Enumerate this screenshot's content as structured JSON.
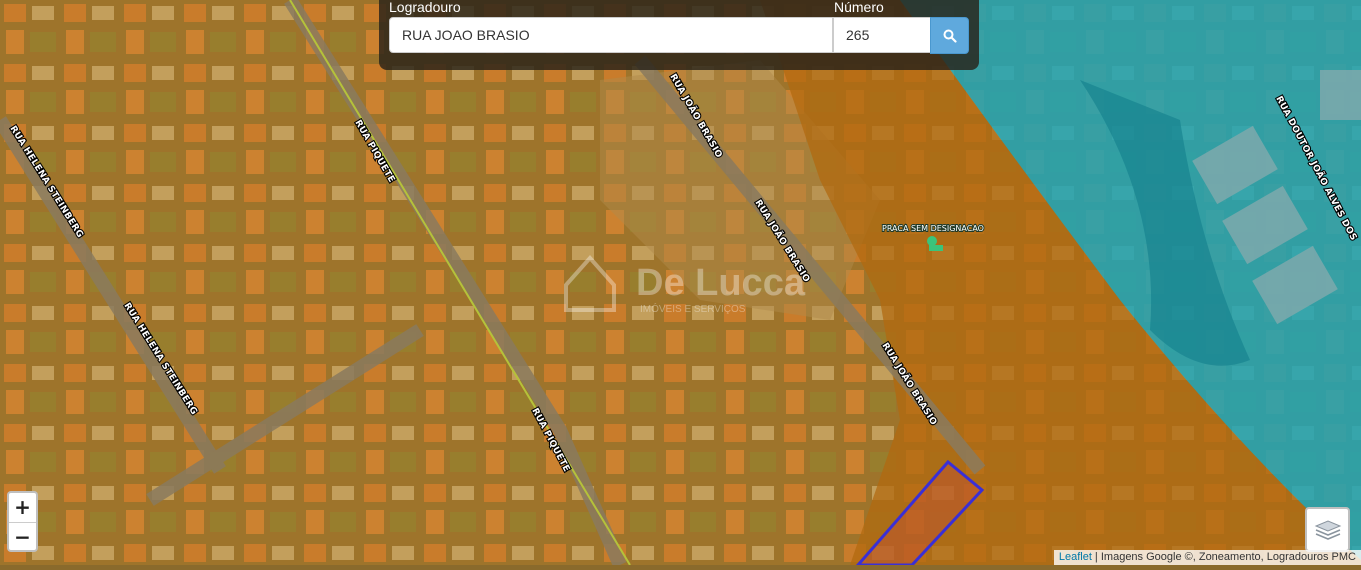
{
  "search": {
    "street_label": "Logradouro",
    "street_value": "RUA JOAO BRASIO",
    "number_label": "Número",
    "number_value": "265",
    "button_icon": "search-icon"
  },
  "map": {
    "street_labels": {
      "helena_1": "RUA HELENA STEINBERG",
      "helena_2": "RUA HELENA STEINBERG",
      "piquete_1": "RUA PIQUETE",
      "piquete_2": "RUA PIQUETE",
      "joao_brasio_1": "RUA JOÃO BRASIO",
      "joao_brasio_2": "RUA JOÃO BRASIO",
      "joao_brasio_3": "RUA JOÃO BRASIO",
      "doutor": "RUA DOUTOR JOÃO ALVES DOS"
    },
    "poi_label": "PRACA SEM DESIGNACAO",
    "watermark": "De Lucca",
    "watermark_sub": "IMÓVEIS E SERVIÇOS",
    "zone_colors": {
      "orange": "#e0901a",
      "teal": "#1fa6b8",
      "parcel": "#3a2fd6"
    }
  },
  "controls": {
    "zoom_in": "+",
    "zoom_out": "−",
    "layers_icon": "layers-icon"
  },
  "attribution": {
    "leaflet": "Leaflet",
    "separator": " | ",
    "sources": "Imagens Google ©, Zoneamento, Logradouros PMC"
  }
}
